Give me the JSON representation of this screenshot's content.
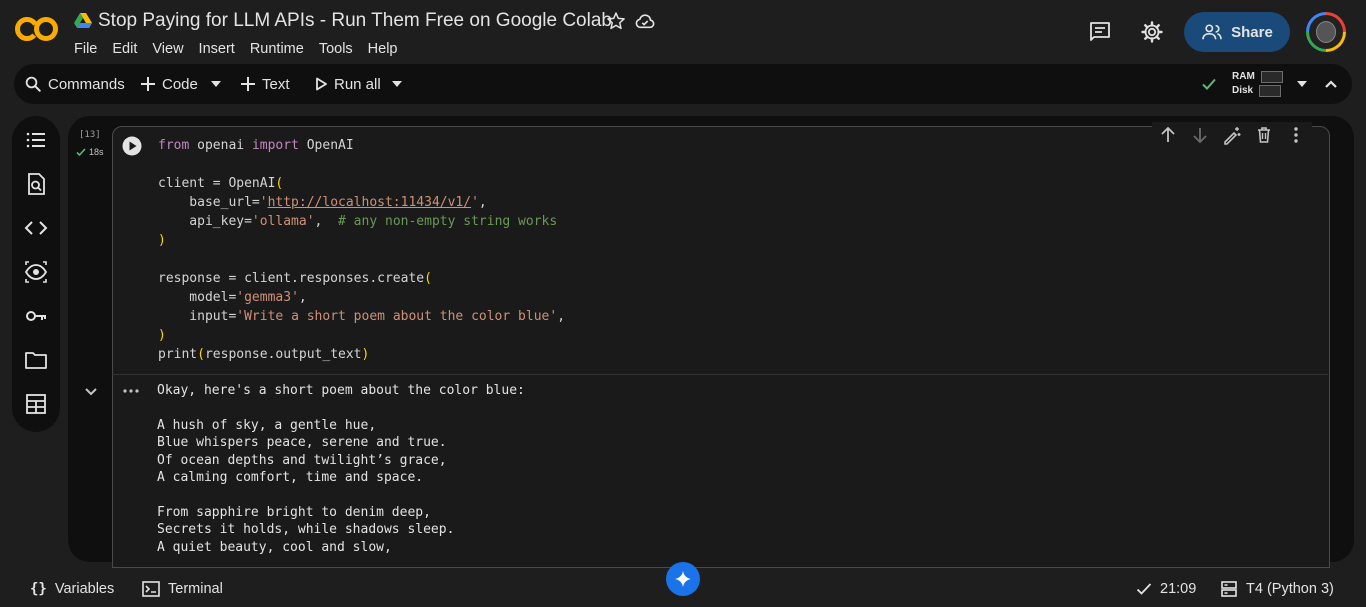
{
  "app": {
    "logo_text": "CO"
  },
  "doc": {
    "title": "Stop Paying for LLM APIs - Run Them Free on Google Colab"
  },
  "menu": [
    "File",
    "Edit",
    "View",
    "Insert",
    "Runtime",
    "Tools",
    "Help"
  ],
  "header": {
    "share_label": "Share"
  },
  "toolbar": {
    "commands_label": "Commands",
    "code_label": "Code",
    "text_label": "Text",
    "run_all_label": "Run all",
    "ram_label": "RAM",
    "disk_label": "Disk"
  },
  "cell": {
    "execution_count": "[13]",
    "execution_time": "18s",
    "code_lines": [
      "from openai import OpenAI",
      "",
      "client = OpenAI(",
      "    base_url='http://localhost:11434/v1/',",
      "    api_key='ollama',  # any non-empty string works",
      ")",
      "",
      "response = client.responses.create(",
      "    model='gemma3',",
      "    input='Write a short poem about the color blue',",
      ")",
      "print(response.output_text)"
    ],
    "output_lines": [
      "Okay, here's a short poem about the color blue:",
      "",
      "A hush of sky, a gentle hue,",
      "Blue whispers peace, serene and true.",
      "Of ocean depths and twilight’s grace,",
      "A calming comfort, time and space.",
      "",
      "From sapphire bright to denim deep,",
      "Secrets it holds, while shadows sleep.",
      "A quiet beauty, cool and slow,"
    ]
  },
  "statusbar": {
    "variables_label": "Variables",
    "terminal_label": "Terminal",
    "time": "21:09",
    "runtime": "T4 (Python 3)"
  },
  "icons": {
    "sidebar": [
      "toc-icon",
      "find-replace-icon",
      "code-snippets-icon",
      "inspect-icon",
      "secrets-key-icon",
      "folder-icon",
      "table-icon"
    ]
  },
  "colors": {
    "accent": "#194a7a",
    "logo": "#f9ab00",
    "keyword": "#c586c0",
    "string": "#ce9178",
    "comment": "#6a9955",
    "gemini": "#1a73e8"
  }
}
